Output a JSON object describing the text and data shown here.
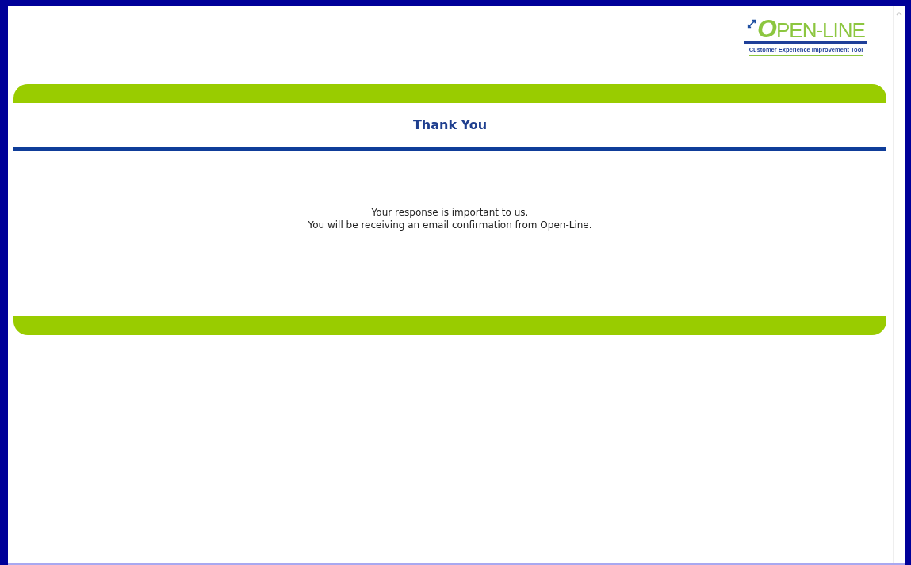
{
  "logo": {
    "name": "OPEN-LINE",
    "tagline": "Customer Experience Improvement Tool"
  },
  "title": "Thank You",
  "message": [
    "Your response is important to us.",
    "You will be receiving an email confirmation from Open-Line."
  ]
}
